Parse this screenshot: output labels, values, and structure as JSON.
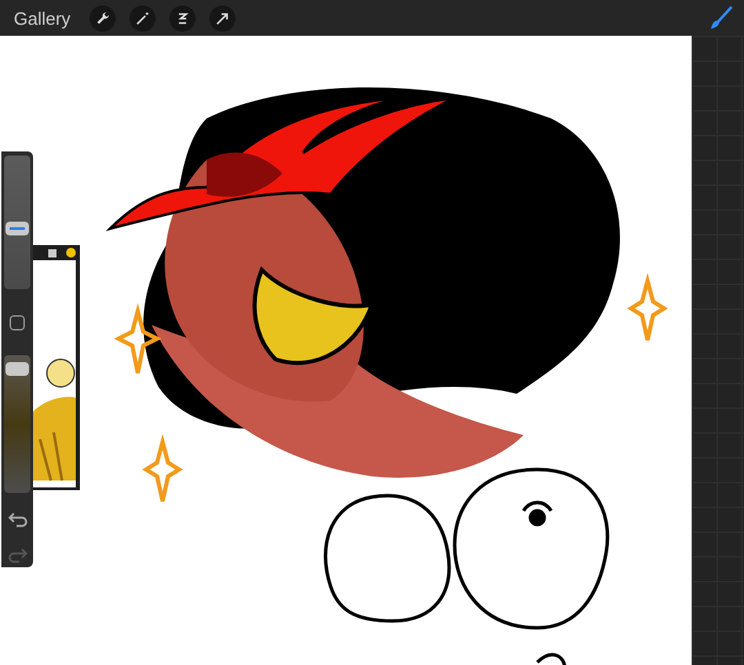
{
  "toolbar": {
    "gallery": "Gallery",
    "tools": [
      {
        "kind": "wrench",
        "selected": false
      },
      {
        "kind": "wand",
        "selected": false
      },
      {
        "kind": "selection",
        "selected": false
      },
      {
        "kind": "transform",
        "selected": false
      }
    ],
    "brush": {
      "selected": true
    }
  },
  "sidebar": {
    "size_slider": {
      "level": 0.45
    },
    "opacity_slider": {
      "level": 0.94
    },
    "undo": {
      "disabled": false
    },
    "redo": {
      "disabled": true
    }
  },
  "reference": {
    "visible": true
  }
}
